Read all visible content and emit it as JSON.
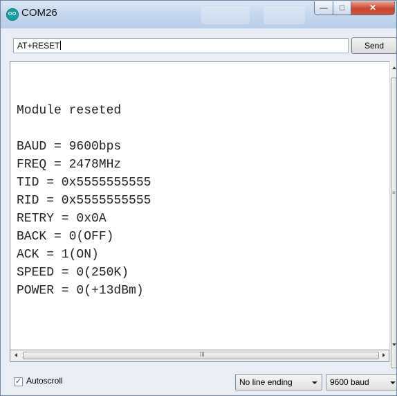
{
  "window": {
    "title": "COM26",
    "app_icon": "arduino-icon",
    "min_symbol": "—",
    "max_symbol": "□",
    "close_symbol": "✕"
  },
  "input": {
    "value": "AT+RESET"
  },
  "send": {
    "label": "Send"
  },
  "output": {
    "lines": [
      "",
      "Module reseted",
      "",
      "BAUD = 9600bps",
      "FREQ = 2478MHz",
      "TID = 0x5555555555",
      "RID = 0x5555555555",
      "RETRY = 0x0A",
      "BACK = 0(OFF)",
      "ACK = 1(ON)",
      "SPEED = 0(250K)",
      "POWER = 0(+13dBm)"
    ]
  },
  "footer": {
    "autoscroll_label": "Autoscroll",
    "autoscroll_checked": true,
    "line_ending": "No line ending",
    "baud": "9600 baud"
  },
  "colors": {
    "title_bar": "#c6d8ee",
    "close_button": "#c9452c",
    "icon": "#14a0a0"
  }
}
